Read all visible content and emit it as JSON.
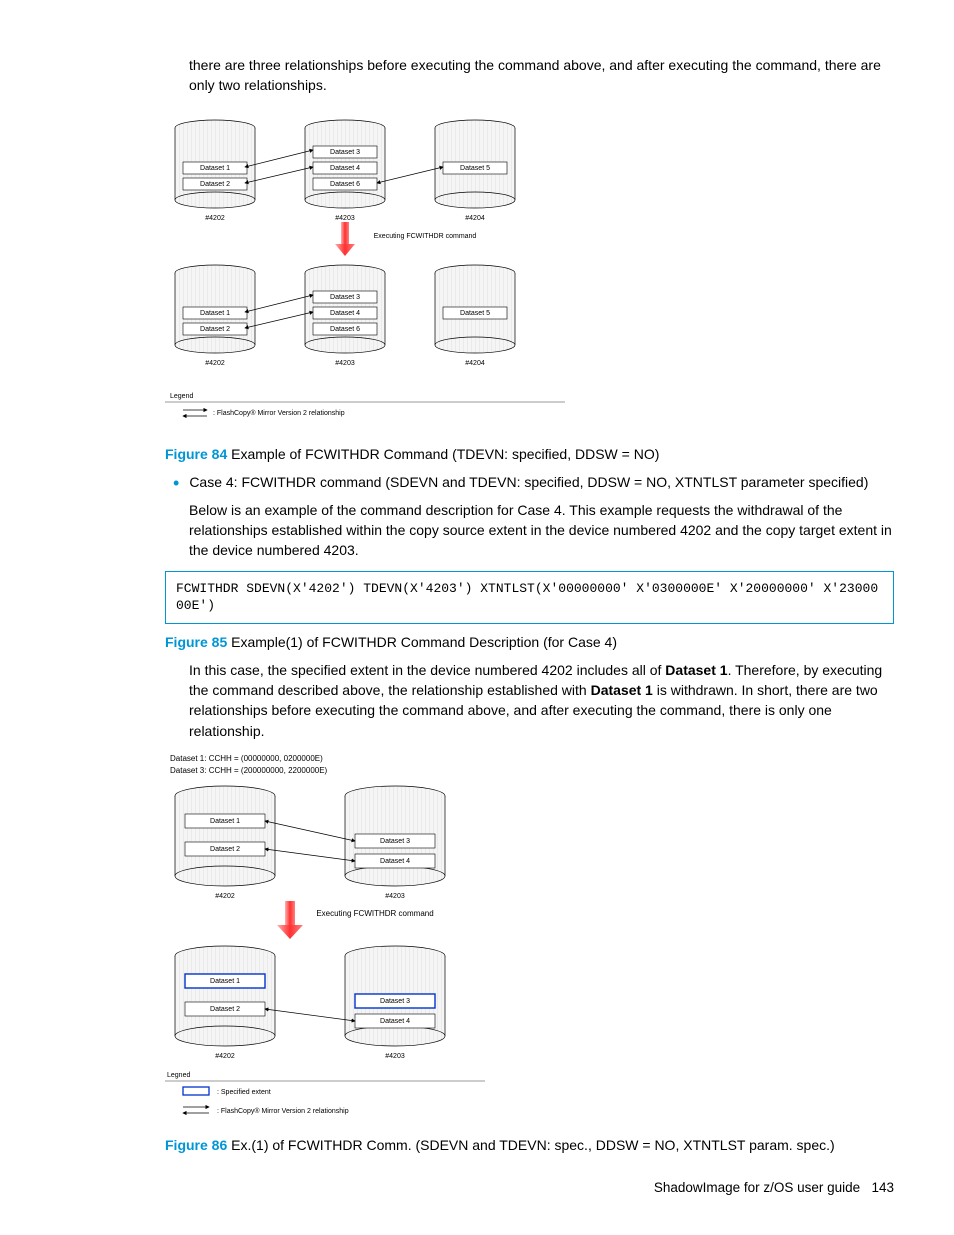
{
  "intro_text": "there are three relationships before executing the command above, and after executing the command, there are only two relationships.",
  "diagram84": {
    "devices": [
      "#4202",
      "#4203",
      "#4204"
    ],
    "datasets_top_4202": [
      "Dataset 1",
      "Dataset 2"
    ],
    "datasets_top_4203": [
      "Dataset 3",
      "Dataset 4",
      "Dataset 6"
    ],
    "datasets_top_4204": [
      "Dataset 5"
    ],
    "exec_label": "Executing FCWITHDR command",
    "datasets_bot_4202": [
      "Dataset 1",
      "Dataset 2"
    ],
    "datasets_bot_4203": [
      "Dataset 3",
      "Dataset 4",
      "Dataset 6"
    ],
    "datasets_bot_4204": [
      "Dataset 5"
    ],
    "legend_title": "Legend",
    "legend_rel": ": FlashCopy® Mirror Version 2 relationship"
  },
  "figure84": {
    "label": "Figure 84",
    "caption": " Example of FCWITHDR Command (TDEVN: specified, DDSW = NO)"
  },
  "case4_bullet": "Case 4: FCWITHDR command (SDEVN and TDEVN: specified, DDSW = NO, XTNTLST parameter specified)",
  "case4_para": "Below is an example of the command description for Case 4. This example requests the withdrawal of the relationships established within the copy source extent in the device numbered 4202 and the copy target extent in the device numbered 4203.",
  "code85": "FCWITHDR SDEVN(X'4202') TDEVN(X'4203') XTNTLST(X'00000000' X'0300000E' X'20000000' X'2300000E')",
  "figure85": {
    "label": "Figure 85",
    "caption": " Example(1) of FCWITHDR Command Description (for Case 4)"
  },
  "case4_result_prefix": "In this case, the specified extent in the device numbered 4202 includes all of ",
  "case4_result_b1": "Dataset 1",
  "case4_result_mid": ". Therefore, by executing the command described above, the relationship established with ",
  "case4_result_b2": "Dataset 1",
  "case4_result_suffix": " is withdrawn. In short, there are two relationships before executing the command above, and after executing the command, there is only one relationship.",
  "diagram86": {
    "cchh1": "Dataset 1:  CCHH = (00000000, 0200000E)",
    "cchh3": "Dataset 3:  CCHH = (200000000, 2200000E)",
    "devices": [
      "#4202",
      "#4203"
    ],
    "datasets_top_4202": [
      "Dataset 1",
      "Dataset 2"
    ],
    "datasets_top_4203": [
      "Dataset 3",
      "Dataset 4"
    ],
    "exec_label": "Executing FCWITHDR command",
    "datasets_bot_4202": [
      "Dataset 1",
      "Dataset 2"
    ],
    "datasets_bot_4203": [
      "Dataset 3",
      "Dataset 4"
    ],
    "legend_title": "Legned",
    "legend_ext": ": Specified extent",
    "legend_rel": ": FlashCopy® Mirror Version 2 relationship"
  },
  "figure86": {
    "label": "Figure 86",
    "caption": " Ex.(1) of FCWITHDR Comm. (SDEVN and TDEVN: spec., DDSW = NO, XTNTLST param. spec.)"
  },
  "footer_text": "ShadowImage for z/OS user guide",
  "footer_page": "143"
}
